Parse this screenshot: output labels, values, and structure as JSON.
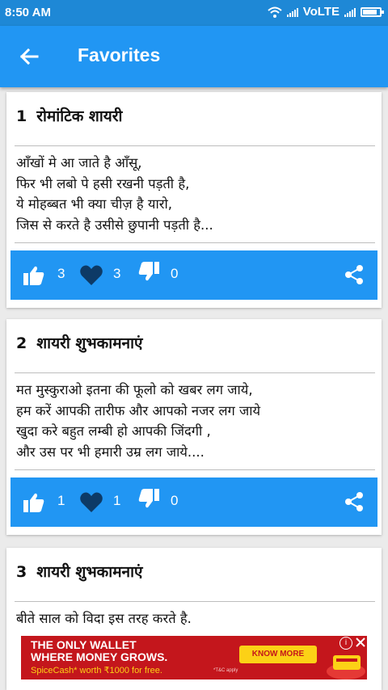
{
  "status_bar": {
    "time": "8:50 AM",
    "network": "VoLTE",
    "icons": [
      "wifi-icon",
      "signal-icon",
      "signal-icon",
      "battery-icon"
    ],
    "battery_level": 0.85
  },
  "app_bar": {
    "title": "Favorites",
    "back_icon": "arrow-left-icon",
    "color": "#2196f3"
  },
  "cards": [
    {
      "number": "1",
      "title": "रोमांटिक शायरी",
      "lines": [
        "आँखों मे आ जाते है आँसू,",
        "फिर भी लबो पे हसी रखनी पड़ती है,",
        "ये मोहब्बत भी क्या चीज़ है यारो,",
        "जिस से करते है उसीसे छुपानी पड़ती है..."
      ],
      "likes": "3",
      "loves": "3",
      "dislikes": "0"
    },
    {
      "number": "2",
      "title": "शायरी शुभकामनाएं",
      "lines": [
        "मत मुस्कुराओ इतना की फूलो को खबर लग जाये,",
        "हम करें आपकी तारीफ और आपको नजर लग जाये",
        "खुदा करे बहुत लम्बी हो आपकी जिंदगी ,",
        "और उस पर भी हमारी उम्र लग जाये...."
      ],
      "likes": "1",
      "loves": "1",
      "dislikes": "0"
    },
    {
      "number": "3",
      "title": "शायरी शुभकामनाएं",
      "lines": [
        "बीते साल को विदा इस तरह करते है."
      ]
    }
  ],
  "ad": {
    "line1": "THE ONLY WALLET",
    "line2": "WHERE MONEY GROWS.",
    "line3": "SpiceCash* worth ₹1000 for free.",
    "tc": "*T&C apply",
    "cta": "KNOW MORE",
    "info": "i",
    "colors": {
      "background": "#c4161c",
      "accent": "#fcd116"
    }
  }
}
